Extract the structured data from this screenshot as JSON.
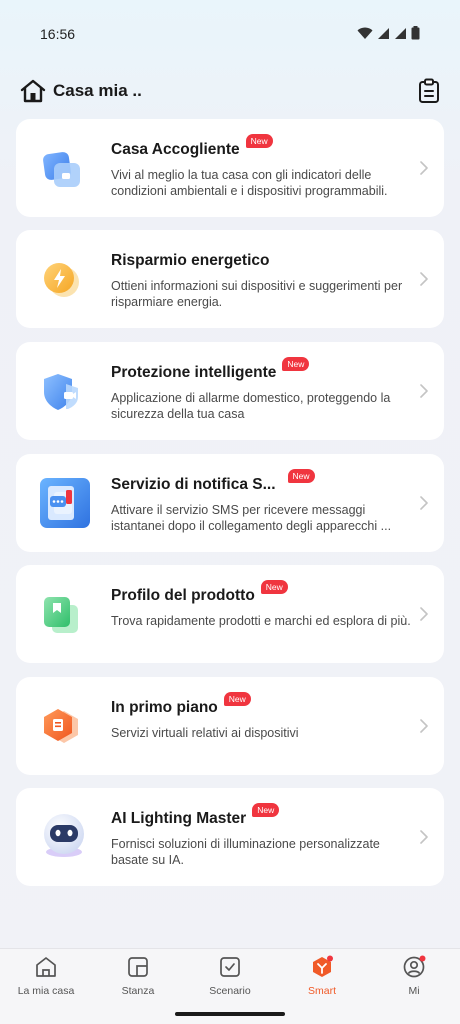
{
  "status_bar": {
    "time": "16:56",
    "icons": [
      "wifi-icon",
      "signal-icon",
      "signal-icon",
      "battery-icon"
    ]
  },
  "header": {
    "title": "Casa mia ..",
    "home_icon": "home-icon",
    "right_icon": "clipboard-icon"
  },
  "cards": [
    {
      "title": "Casa Accogliente",
      "badge": "New",
      "description": "Vivi al meglio la tua casa con gli indicatori delle condizioni ambientali e i dispositivi programmabili.",
      "icon": "welcoming-home-icon"
    },
    {
      "title": "Risparmio energetico",
      "badge": "",
      "description": "Ottieni informazioni sui dispositivi e suggerimenti per risparmiare energia.",
      "icon": "energy-saving-icon"
    },
    {
      "title": "Protezione intelligente",
      "badge": "New",
      "description": "Applicazione di allarme domestico, proteggendo la sicurezza della tua casa",
      "icon": "shield-camera-icon"
    },
    {
      "title": "Servizio di notifica S...",
      "badge": "New",
      "description": "Attivare il servizio SMS per ricevere messaggi istantanei dopo il collegamento degli apparecchi ...",
      "icon": "sms-notification-icon"
    },
    {
      "title": "Profilo del prodotto",
      "badge": "New",
      "description": "Trova rapidamente prodotti e marchi ed esplora di più.",
      "icon": "product-profile-icon"
    },
    {
      "title": "In primo piano",
      "badge": "New",
      "description": "Servizi virtuali relativi ai dispositivi",
      "icon": "featured-icon"
    },
    {
      "title": "AI Lighting Master",
      "badge": "New",
      "description": "Fornisci soluzioni di illuminazione personalizzate basate su IA.",
      "icon": "ai-robot-icon"
    }
  ],
  "bottom_nav": [
    {
      "label": "La mia casa",
      "icon": "home-icon",
      "active": false
    },
    {
      "label": "Stanza",
      "icon": "room-icon",
      "active": false
    },
    {
      "label": "Scenario",
      "icon": "scenario-icon",
      "active": false
    },
    {
      "label": "Smart",
      "icon": "smart-icon",
      "active": true
    },
    {
      "label": "Mi",
      "icon": "profile-icon",
      "active": false
    }
  ],
  "colors": {
    "accent": "#f05a28",
    "badge": "#f0353f",
    "card_bg": "#ffffff"
  }
}
